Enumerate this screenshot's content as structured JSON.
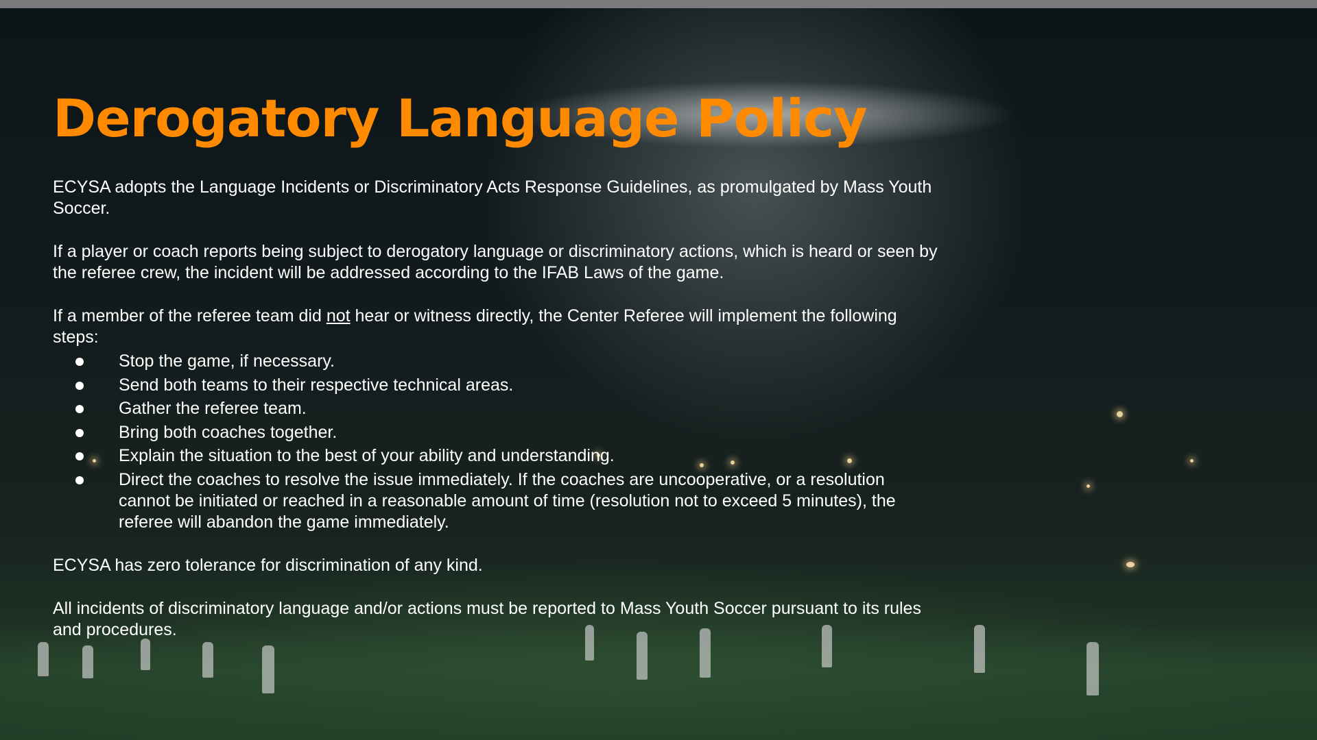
{
  "slide": {
    "title": "Derogatory Language Policy",
    "intro": "ECYSA adopts the Language Incidents or Discriminatory Acts Response Guidelines, as promulgated by Mass Youth Soccer.",
    "para2": "If a player or coach reports being subject to derogatory language or discriminatory actions, which is heard or seen by the referee crew, the incident will be addressed according to the IFAB Laws of the game.",
    "para3": {
      "before": "If a member of the referee team did ",
      "emphasis": "not",
      "after": " hear or witness directly, the Center Referee will implement the following steps:"
    },
    "steps": [
      "Stop the game, if necessary.",
      "Send both teams to their respective technical areas.",
      "Gather the referee team.",
      "Bring both coaches together.",
      "Explain the situation to the best of your ability and understanding.",
      "Direct the coaches to resolve the issue immediately. If the coaches are uncooperative, or a resolution cannot be initiated or reached in a reasonable amount of time (resolution not to exceed 5 minutes), the referee will abandon the game immediately."
    ],
    "zero_tolerance": "ECYSA has zero tolerance for discrimination of any kind.",
    "reporting": "All incidents of discriminatory language and/or actions must be reported to Mass Youth Soccer pursuant to its rules and procedures."
  },
  "colors": {
    "title": "#ff8a00",
    "text": "#ffffff",
    "top_bar": "#7b7b7b"
  }
}
